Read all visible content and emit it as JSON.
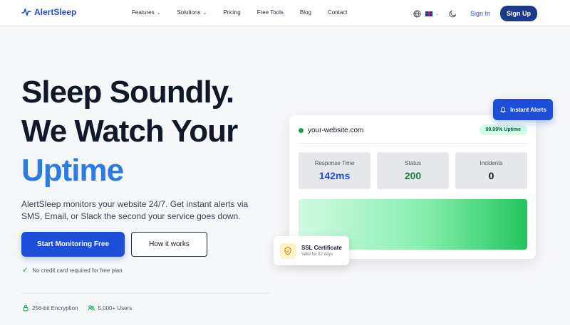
{
  "brand": {
    "name": "AlertSleep",
    "color": "#1d4ed8"
  },
  "nav": {
    "items": [
      {
        "label": "Features",
        "has_dropdown": true
      },
      {
        "label": "Solutions",
        "has_dropdown": true
      },
      {
        "label": "Pricing",
        "has_dropdown": false
      },
      {
        "label": "Free Tools",
        "has_dropdown": false
      },
      {
        "label": "Blog",
        "has_dropdown": false
      },
      {
        "label": "Contact",
        "has_dropdown": false
      }
    ],
    "icons": {
      "language": "globe-icon",
      "flag": "uk-flag-icon",
      "theme": "moon-icon"
    },
    "signin_label": "Sign In",
    "signup_label": "Sign Up"
  },
  "hero": {
    "headline_line1": "Sleep Soundly.",
    "headline_line2": "We Watch Your",
    "headline_accent": "Uptime",
    "accent_color": "#2b7be5",
    "subcopy": "AlertSleep monitors your website 24/7. Get instant alerts via SMS, Email, or Slack the second your service goes down.",
    "cta_primary": "Start Monitoring Free",
    "cta_secondary": "How it works",
    "note": "No credit card required for free plan",
    "trust": [
      {
        "icon": "lock-icon",
        "label": "256-bit Encryption"
      },
      {
        "icon": "users-icon",
        "label": "5,000+ Users"
      }
    ]
  },
  "dashboard": {
    "site": "your-website.com",
    "uptime_badge": "99.99% Uptime",
    "stats": [
      {
        "label": "Response Time",
        "value": "142ms",
        "color": "#1d4ed8"
      },
      {
        "label": "Status",
        "value": "200",
        "color": "#15803d"
      },
      {
        "label": "Incidents",
        "value": "0",
        "color": "#111827"
      }
    ],
    "alert_button": "Instant Alerts",
    "ssl": {
      "title": "SSL Certificate",
      "subtitle": "Valid for 82 days"
    }
  }
}
